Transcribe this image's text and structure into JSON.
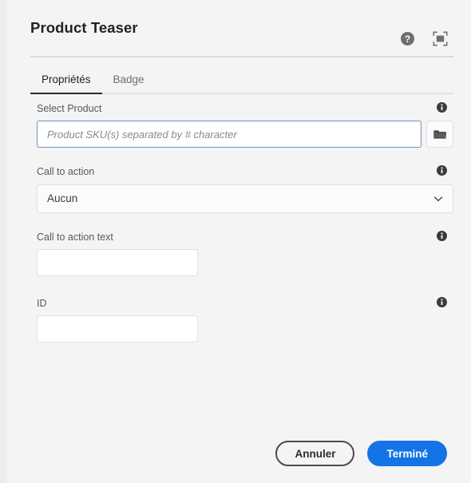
{
  "dialog": {
    "title": "Product Teaser",
    "header_actions": [
      {
        "name": "help-icon",
        "label": "Help"
      },
      {
        "name": "fullscreen-icon",
        "label": "Fullscreen"
      }
    ],
    "tabs": [
      {
        "label": "Propriétés",
        "active": true
      },
      {
        "label": "Badge",
        "active": false
      }
    ],
    "fields": [
      {
        "label": "Select Product",
        "type": "text-with-browse",
        "value": "",
        "placeholder": "Product SKU(s) separated by # character",
        "focused": true,
        "browse_icon": "folder-icon",
        "info_icon": "info-icon"
      },
      {
        "label": "Call to action",
        "type": "select",
        "value": "Aucun",
        "options": [
          "Aucun"
        ],
        "info_icon": "info-icon"
      },
      {
        "label": "Call to action text",
        "type": "text",
        "value": "",
        "placeholder": "",
        "info_icon": "info-icon"
      },
      {
        "label": "ID",
        "type": "text",
        "value": "",
        "placeholder": "",
        "info_icon": "info-icon"
      }
    ],
    "footer": {
      "cancel_label": "Annuler",
      "confirm_label": "Terminé"
    },
    "colors": {
      "accent": "#1473e6",
      "background": "#f4f4f4",
      "page_background": "#eceded",
      "title": "#1f2123",
      "label": "#585858",
      "tab_active_underline": "#2c2c2c",
      "input_focus_border": "#6f93b3"
    }
  }
}
